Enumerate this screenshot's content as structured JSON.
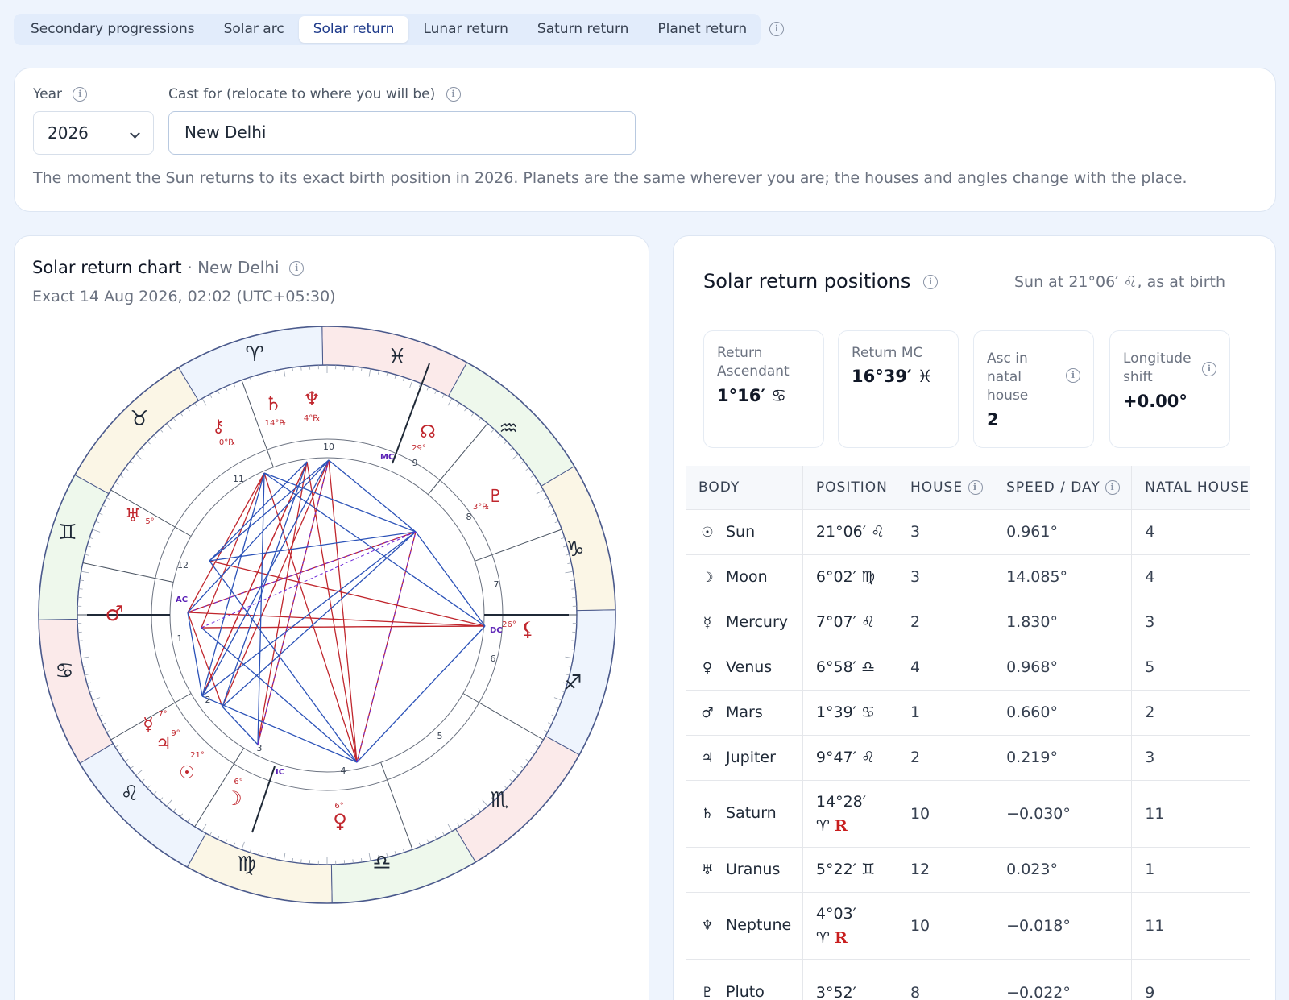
{
  "tabs": [
    "Secondary progressions",
    "Solar arc",
    "Solar return",
    "Lunar return",
    "Saturn return",
    "Planet return"
  ],
  "active_tab": "Solar return",
  "form": {
    "year_label": "Year",
    "year_value": "2026",
    "cast_label": "Cast for (relocate to where you will be)",
    "cast_value": "New Delhi",
    "description": "The moment the Sun returns to its exact birth position in 2026. Planets are the same wherever you are; the houses and angles change with the place."
  },
  "chart": {
    "title": "Solar return chart",
    "location": "New Delhi",
    "exact": "Exact 14 Aug 2026, 02:02 (UTC+05:30)",
    "zodiac_colors": [
      "#fbeaea",
      "#eef4fd",
      "#fbf6e6",
      "#eef8ec"
    ],
    "house_numbers": [
      "10",
      "9",
      "8",
      "7",
      "6",
      "5",
      "4",
      "3",
      "2",
      "1",
      "12",
      "11"
    ],
    "angles": [
      "AC",
      "MC",
      "DC",
      "IC"
    ],
    "planet_labels": [
      "14°℞",
      "4°℞",
      "0°℞",
      "29°",
      "3°℞",
      "5°",
      "26°",
      "7°",
      "9°",
      "21°",
      "6°",
      "6°"
    ],
    "aspect_red": "#c0262d",
    "aspect_blue": "#2b52b8"
  },
  "positions": {
    "title": "Solar return positions",
    "sun_note": "Sun at 21°06′ ♌, as at birth",
    "stats": [
      {
        "label": "Return Ascendant",
        "value": "1°16′ ♋"
      },
      {
        "label": "Return MC",
        "value": "16°39′ ♓"
      },
      {
        "label": "Asc in natal house",
        "value": "2"
      },
      {
        "label": "Longitude shift",
        "value": "+0.00°"
      }
    ],
    "columns": [
      "BODY",
      "POSITION",
      "HOUSE",
      "SPEED / DAY",
      "NATAL HOUSE"
    ],
    "rows": [
      {
        "glyph": "☉",
        "name": "Sun",
        "pos": "21°06′ ♌",
        "retro": "",
        "house": "3",
        "speed": "0.961°",
        "natal": "4"
      },
      {
        "glyph": "☽",
        "name": "Moon",
        "pos": "6°02′ ♍",
        "retro": "",
        "house": "3",
        "speed": "14.085°",
        "natal": "4"
      },
      {
        "glyph": "☿",
        "name": "Mercury",
        "pos": "7°07′ ♌",
        "retro": "",
        "house": "2",
        "speed": "1.830°",
        "natal": "3"
      },
      {
        "glyph": "♀",
        "name": "Venus",
        "pos": "6°58′ ♎",
        "retro": "",
        "house": "4",
        "speed": "0.968°",
        "natal": "5"
      },
      {
        "glyph": "♂",
        "name": "Mars",
        "pos": "1°39′ ♋",
        "retro": "",
        "house": "1",
        "speed": "0.660°",
        "natal": "2"
      },
      {
        "glyph": "♃",
        "name": "Jupiter",
        "pos": "9°47′ ♌",
        "retro": "",
        "house": "2",
        "speed": "0.219°",
        "natal": "3"
      },
      {
        "glyph": "♄",
        "name": "Saturn",
        "pos": "14°28′",
        "pos2": "♈",
        "retro": "R",
        "house": "10",
        "speed": "−0.030°",
        "natal": "11"
      },
      {
        "glyph": "♅",
        "name": "Uranus",
        "pos": "5°22′ ♊",
        "retro": "",
        "house": "12",
        "speed": "0.023°",
        "natal": "1"
      },
      {
        "glyph": "♆",
        "name": "Neptune",
        "pos": "4°03′",
        "pos2": "♈",
        "retro": "R",
        "house": "10",
        "speed": "−0.018°",
        "natal": "11"
      },
      {
        "glyph": "♇",
        "name": "Pluto",
        "pos": "3°52′",
        "pos2": "",
        "retro": "",
        "house": "8",
        "speed": "−0.022°",
        "natal": "9"
      }
    ]
  }
}
